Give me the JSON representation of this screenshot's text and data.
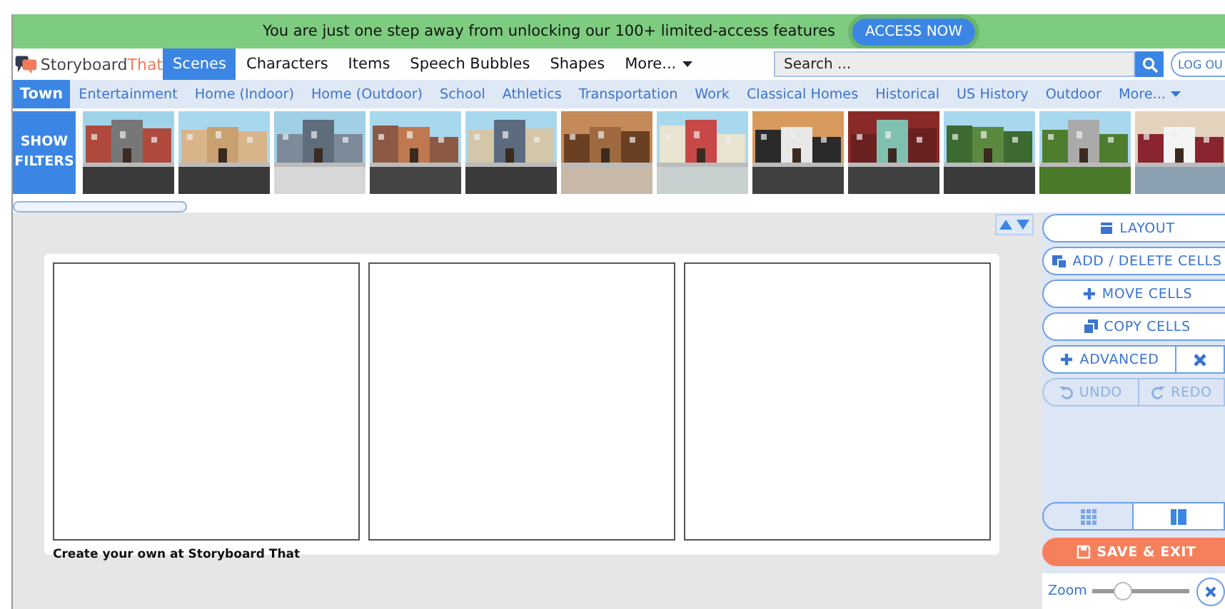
{
  "banner": {
    "message": "You are just one step away from unlocking our 100+ limited-access features",
    "button": "ACCESS NOW"
  },
  "nav": {
    "logo": {
      "first": "Storyboard",
      "second": "That"
    },
    "tabs": [
      {
        "label": "Scenes",
        "selected": true,
        "kind": "link"
      },
      {
        "label": "Characters",
        "selected": false,
        "kind": "link"
      },
      {
        "label": "Items",
        "selected": false,
        "kind": "link"
      },
      {
        "label": "Speech Bubbles",
        "selected": false,
        "kind": "link"
      },
      {
        "label": "Shapes",
        "selected": false,
        "kind": "link"
      },
      {
        "label": "More...",
        "selected": false,
        "kind": "dropdown"
      }
    ],
    "search": {
      "placeholder": "Search ..."
    },
    "logout": "LOG OU"
  },
  "categories": [
    {
      "label": "Town",
      "selected": true,
      "kind": "link"
    },
    {
      "label": "Entertainment",
      "selected": false,
      "kind": "link"
    },
    {
      "label": "Home (Indoor)",
      "selected": false,
      "kind": "link"
    },
    {
      "label": "Home (Outdoor)",
      "selected": false,
      "kind": "link"
    },
    {
      "label": "School",
      "selected": false,
      "kind": "link"
    },
    {
      "label": "Athletics",
      "selected": false,
      "kind": "link"
    },
    {
      "label": "Transportation",
      "selected": false,
      "kind": "link"
    },
    {
      "label": "Work",
      "selected": false,
      "kind": "link"
    },
    {
      "label": "Classical Homes",
      "selected": false,
      "kind": "link"
    },
    {
      "label": "Historical",
      "selected": false,
      "kind": "link"
    },
    {
      "label": "US History",
      "selected": false,
      "kind": "link"
    },
    {
      "label": "Outdoor",
      "selected": false,
      "kind": "link"
    },
    {
      "label": "More...",
      "selected": false,
      "kind": "dropdown"
    }
  ],
  "filters_button": "SHOW FILTERS",
  "storyboard": {
    "cells": [
      {
        "kind": "empty"
      },
      {
        "kind": "empty"
      },
      {
        "kind": "empty"
      }
    ],
    "credit": "Create your own at Storyboard That"
  },
  "tools": [
    {
      "label": "LAYOUT",
      "kind": "layout"
    },
    {
      "label": "ADD / DELETE CELLS",
      "kind": "add-delete"
    },
    {
      "label": "MOVE CELLS",
      "kind": "move"
    },
    {
      "label": "COPY CELLS",
      "kind": "copy"
    },
    {
      "label": "ADVANCED",
      "kind": "advanced"
    }
  ],
  "history": [
    {
      "label": "UNDO",
      "kind": "undo",
      "disabled": true
    },
    {
      "label": "REDO",
      "kind": "redo",
      "disabled": true
    }
  ],
  "views": [
    {
      "kind": "grid",
      "selected": false
    },
    {
      "kind": "columns",
      "selected": true
    }
  ],
  "save_button": "SAVE & EXIT",
  "zoom": {
    "label": "Zoom",
    "level": 0.3
  }
}
